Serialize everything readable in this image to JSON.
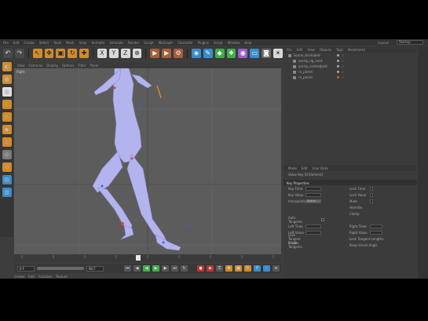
{
  "menubar": {
    "items": [
      "File",
      "Edit",
      "Create",
      "Select",
      "Tools",
      "Mesh",
      "Snap",
      "Animate",
      "Simulate",
      "Render",
      "Sculpt",
      "MoGraph",
      "Character",
      "Plugins",
      "Script",
      "Window",
      "Help"
    ],
    "layout_label": "Layout:",
    "layout_value": "Startup"
  },
  "viewport": {
    "menu": [
      "View",
      "Cameras",
      "Display",
      "Options",
      "Filter",
      "Panel"
    ],
    "camera_label": "Right"
  },
  "object_manager": {
    "menu": [
      "File",
      "Edit",
      "View",
      "Objects",
      "Tags",
      "Bookmarks"
    ],
    "objects": [
      "Scene_Animated",
      "ascrip_rig_neck",
      "ascrip_controlJoint",
      "rn_pared",
      "rn_pared"
    ]
  },
  "attribute_manager": {
    "menu": [
      "Mode",
      "Edit",
      "User Data"
    ],
    "subtitle": "Value Key [0 Element]",
    "section": "Key Properties",
    "rows": [
      {
        "label": "Key Time",
        "value": "",
        "label2": "Lock Time"
      },
      {
        "label": "Key Value",
        "value": "",
        "label2": "Lock Value"
      },
      {
        "label": "Interpolation",
        "value": "Spline",
        "label2": "Mute"
      },
      {
        "label": "",
        "value": "",
        "label2": "Hermite"
      },
      {
        "label": "",
        "value": "",
        "label2": "Clamp"
      },
      {
        "label": "Auto Tangents",
        "value": "",
        "label2": ""
      },
      {
        "label": "Left Time",
        "value": "",
        "label2": "Right Time"
      },
      {
        "label": "Left Value",
        "value": "",
        "label2": "Right Value"
      },
      {
        "label": "Lock Tangent Angles",
        "value": "",
        "label2": "Lock Tangent Lengths"
      },
      {
        "label": "Break Tangents",
        "value": "",
        "label2": "Keep Visual Angle"
      }
    ]
  },
  "material_manager": {
    "menu": [
      "Create",
      "Edit",
      "Function",
      "Texture"
    ]
  },
  "transport": {
    "start_frame": "0 F",
    "end_frame": "90 F"
  }
}
